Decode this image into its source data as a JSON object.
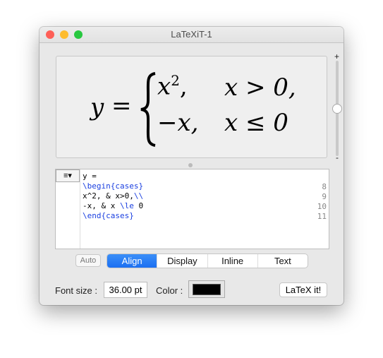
{
  "window": {
    "title": "LaTeXiT-1",
    "controls": {
      "close": "#fe5f57",
      "minimize": "#febc2e",
      "zoom": "#28c840"
    }
  },
  "preview": {
    "y": "y",
    "eq": "=",
    "row1_a": "x",
    "row1_sup": "2",
    "row1_comma": ",",
    "row1_b": "x > 0,",
    "row2_a": "−x,",
    "row2_b": "x ≤ 0"
  },
  "zoom_slider": {
    "plus": "+",
    "minus": "-",
    "value": 0.45
  },
  "editor": {
    "menu_icon": "≡▾",
    "line_numbers": [
      "",
      "8",
      "9",
      "10",
      "11"
    ],
    "lines": [
      [
        {
          "t": "y =",
          "c": "black"
        }
      ],
      [
        {
          "t": "\\begin{cases}",
          "c": "blue"
        }
      ],
      [
        {
          "t": "x^2, & x>0,",
          "c": "black"
        },
        {
          "t": "\\\\",
          "c": "blue"
        }
      ],
      [
        {
          "t": "-x, & x ",
          "c": "black"
        },
        {
          "t": "\\le",
          "c": "blue"
        },
        {
          "t": " 0",
          "c": "black"
        }
      ],
      [
        {
          "t": "\\end{cases}",
          "c": "blue"
        }
      ]
    ]
  },
  "auto_label": "Auto",
  "modes": [
    {
      "label": "Align",
      "selected": true
    },
    {
      "label": "Display",
      "selected": false
    },
    {
      "label": "Inline",
      "selected": false
    },
    {
      "label": "Text",
      "selected": false
    }
  ],
  "font_size_label": "Font size :",
  "font_size_value": "36.00 pt",
  "color_label": "Color :",
  "color_value": "#000000",
  "latex_button": "LaTeX it!"
}
